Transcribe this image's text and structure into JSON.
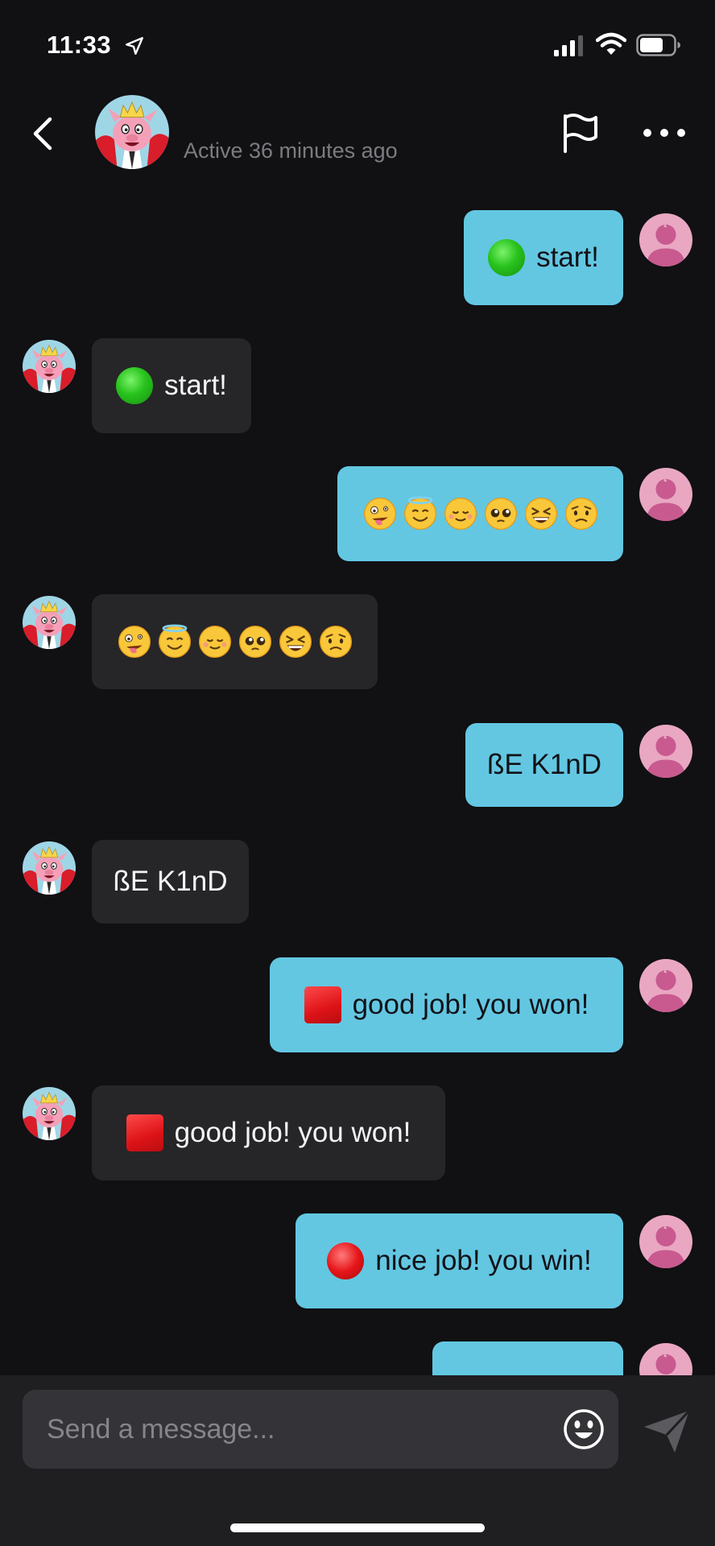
{
  "status_bar": {
    "time": "11:33",
    "icons": [
      "location-arrow-icon",
      "cellular-signal-icon",
      "wifi-icon",
      "battery-icon"
    ]
  },
  "header": {
    "active_status": "Active 36 minutes ago",
    "icons": [
      "back-chevron-icon",
      "flag-icon",
      "more-dots-icon"
    ]
  },
  "messages": [
    {
      "side": "sent",
      "icon": "green-circle-emoji",
      "text": "start!"
    },
    {
      "side": "received",
      "icon": "green-circle-emoji",
      "text": "start!"
    },
    {
      "side": "sent",
      "emojis": [
        "zany-face",
        "smiling-face-with-halo",
        "smiling-face",
        "pleading-face",
        "grinning-squinting-face",
        "worried-face"
      ]
    },
    {
      "side": "received",
      "emojis": [
        "zany-face",
        "smiling-face-with-halo",
        "smiling-face",
        "pleading-face",
        "grinning-squinting-face",
        "worried-face"
      ]
    },
    {
      "side": "sent",
      "text": "ßE K1nD"
    },
    {
      "side": "received",
      "text": "ßE K1nD"
    },
    {
      "side": "sent",
      "icon": "red-square-emoji",
      "text": "good job! you won!"
    },
    {
      "side": "received",
      "icon": "red-square-emoji",
      "text": "good job! you won!"
    },
    {
      "side": "sent",
      "icon": "red-circle-emoji",
      "text": "nice job! you win!"
    }
  ],
  "input": {
    "placeholder": "Send a message..."
  },
  "colors": {
    "background": "#111013",
    "sent_bubble": "#63c7e2",
    "received_bubble": "#262528",
    "input_bar": "#1f1e21"
  }
}
